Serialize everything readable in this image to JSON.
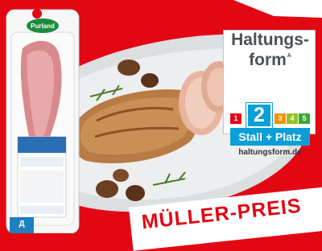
{
  "package": {
    "brand": "Purland"
  },
  "haltungsform": {
    "title": "Haltungs-form",
    "superscript": "A",
    "current_level": "2",
    "levels": [
      "1",
      "2",
      "3",
      "4",
      "5"
    ],
    "level_colors": [
      "#e30613",
      "#0a9fd6",
      "#f39200",
      "#95c11f",
      "#3aa935"
    ],
    "category": "Stall + Platz",
    "url": "haltungsform.de"
  },
  "promo": {
    "text": "MÜLLER-PREIS"
  },
  "corner_chip": {
    "text": "Д"
  }
}
